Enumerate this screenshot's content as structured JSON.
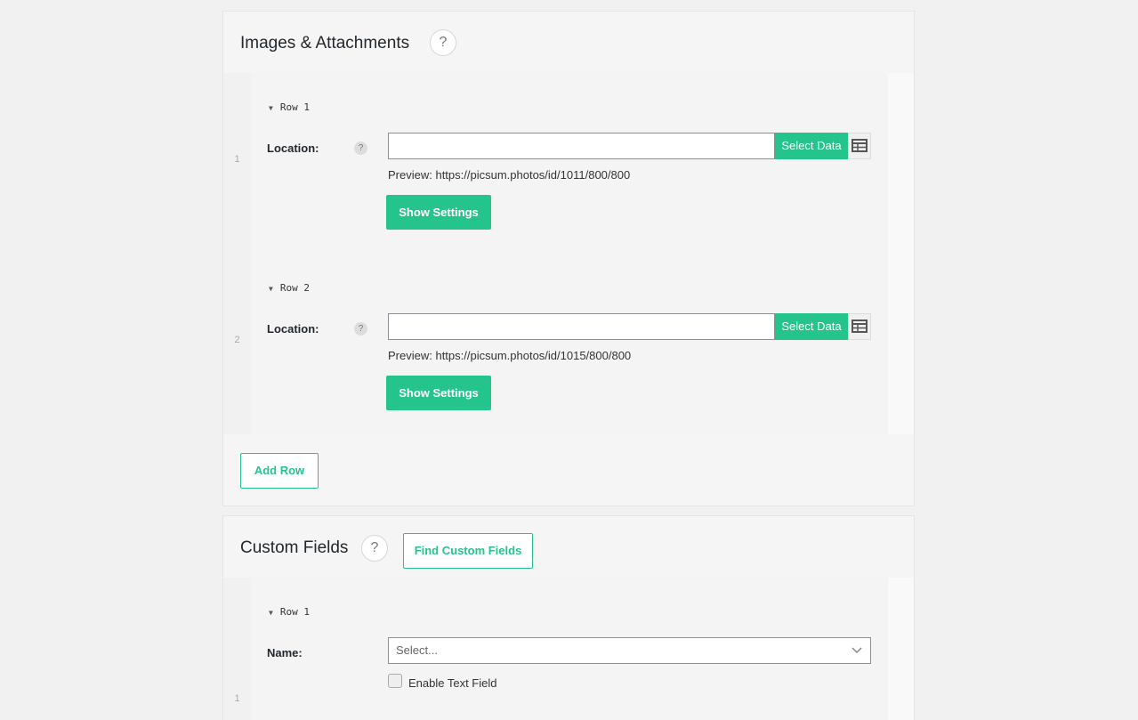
{
  "images_panel": {
    "title": "Images & Attachments",
    "help": "?",
    "rows": [
      {
        "index": "1",
        "toggle": "Row 1",
        "label": "Location:",
        "mini_help": "?",
        "value": "",
        "select_data": "Select Data",
        "preview": "Preview: https://picsum.photos/id/1011/800/800",
        "show_settings": "Show Settings"
      },
      {
        "index": "2",
        "toggle": "Row 2",
        "label": "Location:",
        "mini_help": "?",
        "value": "",
        "select_data": "Select Data",
        "preview": "Preview: https://picsum.photos/id/1015/800/800",
        "show_settings": "Show Settings"
      }
    ],
    "add_row": "Add Row"
  },
  "custom_fields_panel": {
    "title": "Custom Fields",
    "help": "?",
    "find_button": "Find Custom Fields",
    "rows": [
      {
        "index": "1",
        "toggle": "Row 1",
        "label": "Name:",
        "select_placeholder": "Select...",
        "checkbox_label": "Enable Text Field"
      }
    ]
  },
  "colors": {
    "accent": "#25c48d"
  },
  "icons": {
    "caret": "caret-down-icon",
    "table": "table-icon",
    "chevron": "chevron-down-icon"
  }
}
